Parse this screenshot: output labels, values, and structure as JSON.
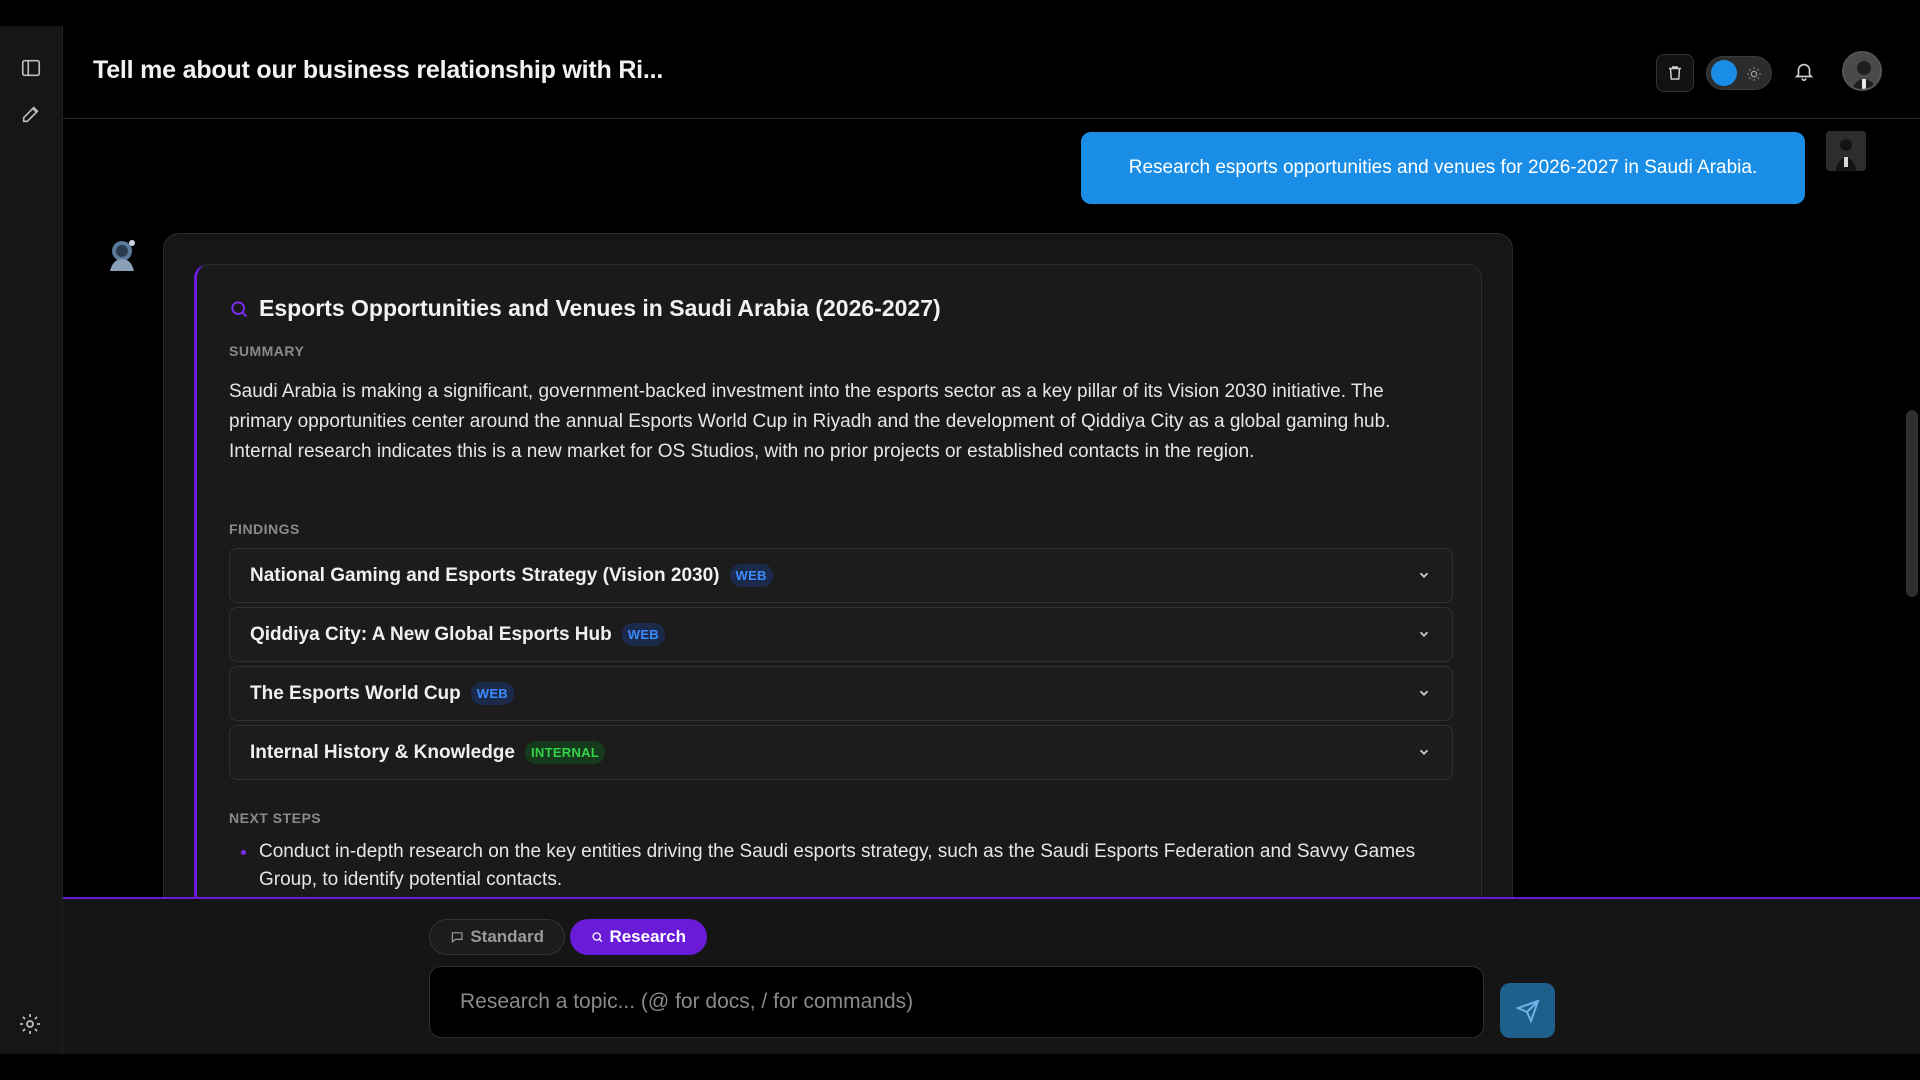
{
  "header": {
    "title": "Tell me about our business relationship with Ri..."
  },
  "user_message": {
    "text": "Research esports opportunities and venues for 2026-2027 in Saudi Arabia."
  },
  "report": {
    "title": "Esports Opportunities and Venues in Saudi Arabia (2026-2027)",
    "summary_label": "SUMMARY",
    "summary": "Saudi Arabia is making a significant, government-backed investment into the esports sector as a key pillar of its Vision 2030 initiative. The primary opportunities center around the annual Esports World Cup in Riyadh and the development of Qiddiya City as a global gaming hub. Internal research indicates this is a new market for OS Studios, with no prior projects or established contacts in the region.",
    "findings_label": "FINDINGS",
    "findings": [
      {
        "label": "National Gaming and Esports Strategy (Vision 2030)",
        "badge": "WEB"
      },
      {
        "label": "Qiddiya City: A New Global Esports Hub",
        "badge": "WEB"
      },
      {
        "label": "The Esports World Cup",
        "badge": "WEB"
      },
      {
        "label": "Internal History & Knowledge",
        "badge": "INTERNAL"
      }
    ],
    "next_steps_label": "NEXT STEPS",
    "next_steps": [
      "Conduct in-depth research on the key entities driving the Saudi esports strategy, such as the Saudi Esports Federation and Savvy Games Group, to identify potential contacts."
    ]
  },
  "composer": {
    "mode_standard": "Standard",
    "mode_research": "Research",
    "placeholder": "Research a topic... (@ for docs, / for commands)"
  },
  "colors": {
    "accent_blue": "#1a8ee6",
    "accent_purple": "#6a1bd8",
    "badge_web": "#3d8bff",
    "badge_internal": "#34d34a"
  },
  "icons": {
    "sidebar_toggle": "sidebar-toggle-icon",
    "new_chat": "edit-icon",
    "settings": "gear-icon",
    "trash": "trash-icon",
    "sun": "sun-icon",
    "bell": "bell-icon",
    "search": "search-icon",
    "chat": "chat-bubble-icon",
    "send": "send-icon",
    "chevron": "chevron-down-icon"
  }
}
